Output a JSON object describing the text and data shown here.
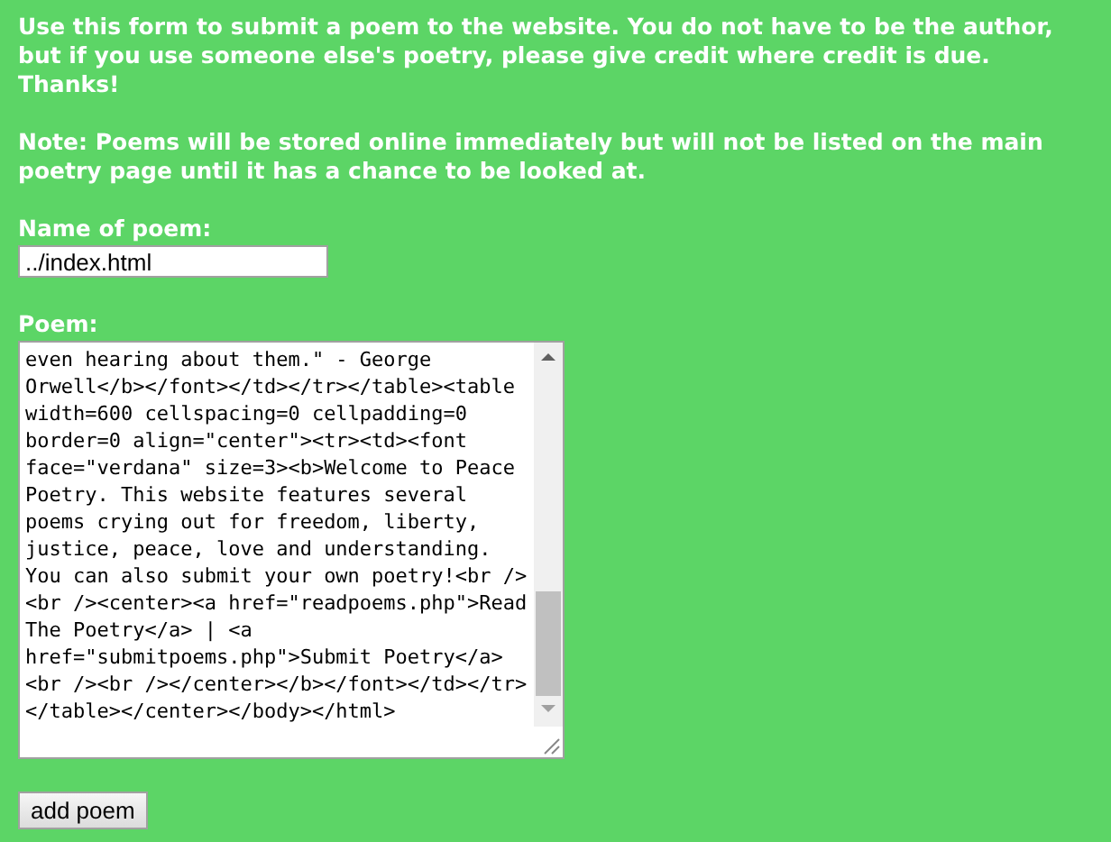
{
  "intro": "Use this form to submit a poem to the website. You do not have to be the author, but if you use someone else's poetry, please give credit where credit is due. Thanks!",
  "note": "Note: Poems will be stored online immediately but will not be listed on the main poetry page until it has a chance to be looked at.",
  "name_field": {
    "label": "Name of poem:",
    "value": "../index.html"
  },
  "poem_field": {
    "label": "Poem:",
    "value_lines": [
      "even hearing about them.\" - George",
      "Orwell</b></font></td></tr></table><table",
      "width=600 cellspacing=0 cellpadding=0",
      "border=0 align=\"center\"><tr><td><font",
      "face=\"verdana\" size=3><b>Welcome to Peace",
      "Poetry. This website features several",
      "poems crying out for freedom, liberty,",
      "justice, peace, love and understanding.",
      "You can also submit your own poetry!<br />",
      "<br /><center><a href=\"readpoems.php\">Read",
      "The Poetry</a> | <a",
      "href=\"submitpoems.php\">Submit Poetry</a>",
      "<br /><br /></center></b></font></td></tr>",
      "</table></center></body></html>"
    ]
  },
  "submit_button": {
    "label": "add poem"
  }
}
